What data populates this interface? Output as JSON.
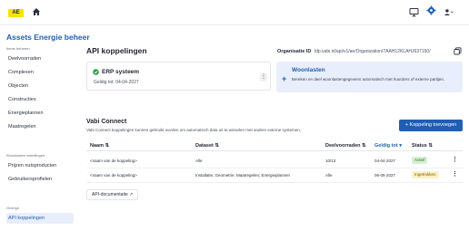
{
  "topbar": {
    "logo_text": "AE",
    "icons": [
      "home-icon",
      "monitor-icon",
      "gear-icon",
      "user-icon"
    ]
  },
  "sidebar": {
    "app_title": "Assets Energie beheer",
    "sections": [
      {
        "title": "Items beheren",
        "items": [
          "Deelvoorraden",
          "Complexen",
          "Objecten",
          "Constructies",
          "Energieplannen",
          "Maatregelen"
        ]
      },
      {
        "title": "Woonlasten instellingen",
        "items": [
          "Prijzen nutsproducten",
          "Gebruikersprofielen"
        ]
      },
      {
        "title": "Overige",
        "items": [
          "API koppelingen"
        ]
      }
    ],
    "active_item": "API koppelingen"
  },
  "main": {
    "page_title": "API koppelingen",
    "org_label": "Organisatie ID",
    "org_value": "ldp.vabi.nl/api/v1/ae/Organization/7AAH12KLAHJ637150/",
    "cards": {
      "erp": {
        "title": "ERP systeem",
        "valid_until": "Geldig tot: 04-04-2027",
        "menu": "⋮"
      },
      "woonlasten": {
        "title": "Woonlasten",
        "description": "Bereken en deel woonlastengegevens automatisch met huurders of externe partijen.",
        "plus": "+"
      }
    },
    "vabi": {
      "title": "Vabi Connect",
      "description": "Vabi Connect koppelingen kunnen gebruikt worden om automatisch data uit te wisselen met andere externe systemen.",
      "add_button": "+ Koppeling toevoegen"
    },
    "table": {
      "columns": [
        "Naam",
        "Dataset",
        "Deelvoorraden",
        "Geldig tot",
        "Status"
      ],
      "sort_marks": [
        "⇅",
        "⇅",
        "⇅",
        "▾",
        "⇅"
      ],
      "rows": [
        {
          "name": "<naam van de koppeling>",
          "dataset": "Alle",
          "deelvoorraden": "10/13",
          "valid_until": "04-04-2027",
          "status": "Actief",
          "menu": "⋮"
        },
        {
          "name": "<naam van de koppeling>",
          "dataset": "Installatie; Geometrie; Maatregelen; Energieplannen",
          "deelvoorraden": "Alle",
          "valid_until": "06-05-2027",
          "status": "Ingetrokken",
          "menu": "⋮"
        }
      ]
    },
    "doc_link": "API-documentatie ↗"
  },
  "colors": {
    "accent": "#1f5fb3",
    "logo": "#f5e500",
    "active_badge": "#d7f0d4",
    "revoked_badge": "#fbf1c2"
  }
}
